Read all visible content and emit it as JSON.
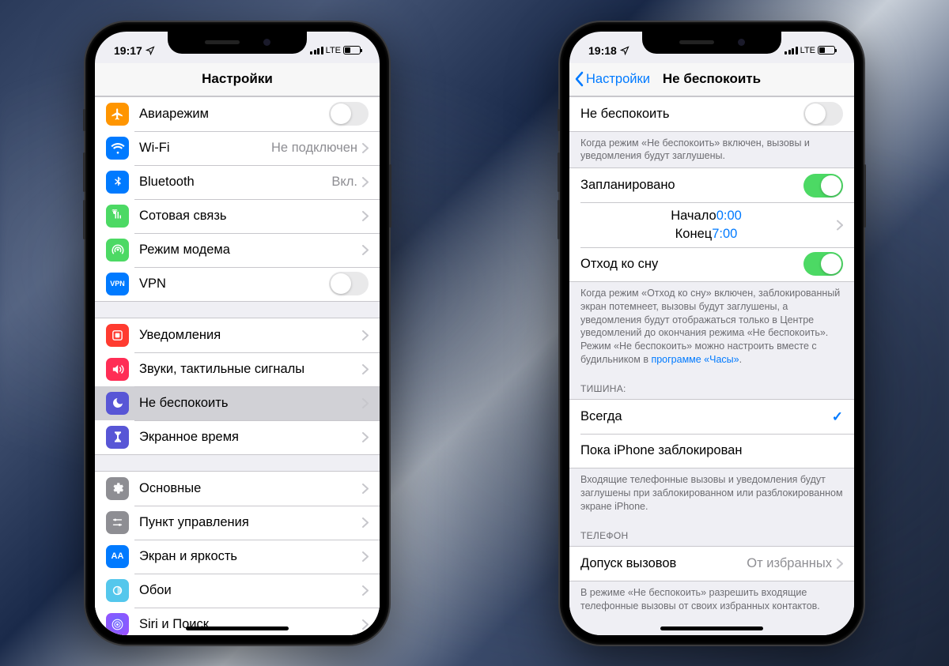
{
  "left": {
    "status": {
      "time": "19:17",
      "carrier": "LTE"
    },
    "nav": {
      "title": "Настройки"
    },
    "group1": [
      {
        "label": "Авиарежим",
        "toggle": "off",
        "iconName": "airplane-icon",
        "bg": "bg-orange",
        "glyph": "✈"
      },
      {
        "label": "Wi-Fi",
        "value": "Не подключен",
        "iconName": "wifi-icon",
        "bg": "bg-blue",
        "glyph": "\u0000"
      },
      {
        "label": "Bluetooth",
        "value": "Вкл.",
        "iconName": "bluetooth-icon",
        "bg": "bg-bluetooth",
        "glyph": "\u0000"
      },
      {
        "label": "Сотовая связь",
        "chevron": true,
        "iconName": "cellular-icon",
        "bg": "bg-green",
        "glyph": "\u0000"
      },
      {
        "label": "Режим модема",
        "chevron": true,
        "iconName": "hotspot-icon",
        "bg": "bg-green2",
        "glyph": "\u0000"
      },
      {
        "label": "VPN",
        "toggle": "off",
        "iconName": "vpn-icon",
        "bg": "bg-vpnblue",
        "glyph": "VPN",
        "small": true
      }
    ],
    "group2": [
      {
        "label": "Уведомления",
        "chevron": true,
        "iconName": "notifications-icon",
        "bg": "bg-red",
        "glyph": "\u0000"
      },
      {
        "label": "Звуки, тактильные сигналы",
        "chevron": true,
        "iconName": "sounds-icon",
        "bg": "bg-red2",
        "glyph": "\u0000"
      },
      {
        "label": "Не беспокоить",
        "chevron": true,
        "iconName": "dnd-icon",
        "bg": "bg-purple",
        "glyph": "\u0000",
        "selected": true
      },
      {
        "label": "Экранное время",
        "chevron": true,
        "iconName": "screentime-icon",
        "bg": "bg-indigo",
        "glyph": "\u0000"
      }
    ],
    "group3": [
      {
        "label": "Основные",
        "chevron": true,
        "iconName": "general-icon",
        "bg": "bg-gray",
        "glyph": "\u0000"
      },
      {
        "label": "Пункт управления",
        "chevron": true,
        "iconName": "controlcenter-icon",
        "bg": "bg-gray2",
        "glyph": "\u0000"
      },
      {
        "label": "Экран и яркость",
        "chevron": true,
        "iconName": "display-icon",
        "bg": "bg-displayblue",
        "glyph": "AA",
        "small": true
      },
      {
        "label": "Обои",
        "chevron": true,
        "iconName": "wallpaper-icon",
        "bg": "bg-teal",
        "glyph": "\u0000"
      },
      {
        "label": "Siri и Поиск",
        "chevron": true,
        "iconName": "siri-icon",
        "bg": "bg-grad",
        "glyph": "\u0000"
      }
    ]
  },
  "right": {
    "status": {
      "time": "19:18",
      "carrier": "LTE"
    },
    "nav": {
      "back": "Настройки",
      "title": "Не беспокоить"
    },
    "dnd": {
      "label": "Не беспокоить",
      "toggle": "off"
    },
    "dnd_footer": "Когда режим «Не беспокоить» включен, вызовы и уведомления будут заглушены.",
    "scheduled": {
      "label": "Запланировано",
      "toggle": "on"
    },
    "time": {
      "fromLabel": "Начало",
      "fromValue": "0:00",
      "toLabel": "Конец",
      "toValue": "7:00"
    },
    "bedtime": {
      "label": "Отход ко сну",
      "toggle": "on"
    },
    "bedtime_footer_pre": "Когда режим «Отход ко сну» включен, заблокированный экран потемнеет, вызовы будут заглушены, а уведомления будут отображаться только в Центре уведомлений до окончания режима «Не беспокоить». Режим «Не беспокоить» можно настроить вместе с будильником в ",
    "bedtime_footer_link": "программе «Часы»",
    "silence_header": "ТИШИНА:",
    "silence_always": "Всегда",
    "silence_locked": "Пока iPhone заблокирован",
    "silence_footer": "Входящие телефонные вызовы и уведомления будут заглушены при заблокированном или разблокированном экране iPhone.",
    "phone_header": "ТЕЛЕФОН",
    "allowcalls": {
      "label": "Допуск вызовов",
      "value": "От избранных"
    },
    "allowcalls_footer": "В режиме «Не беспокоить» разрешить входящие телефонные вызовы от своих избранных контактов."
  }
}
